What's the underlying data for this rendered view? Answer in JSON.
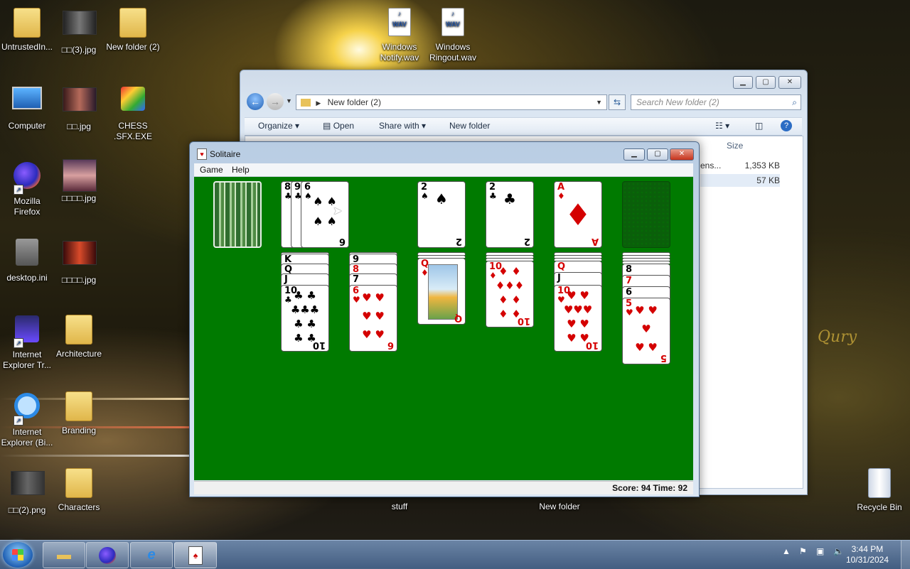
{
  "desktop": {
    "icons": [
      {
        "label": "UntrustedIn..."
      },
      {
        "label": "□□(3).jpg"
      },
      {
        "label": "New folder (2)"
      },
      {
        "label": "Windows Notify.wav"
      },
      {
        "label": "Windows Ringout.wav"
      },
      {
        "label": "Computer"
      },
      {
        "label": "□□.jpg"
      },
      {
        "label": "CHESS .SFX.EXE"
      },
      {
        "label": "Mozilla Firefox"
      },
      {
        "label": "□□□□.jpg"
      },
      {
        "label": "desktop.ini"
      },
      {
        "label": "□□□□.jpg"
      },
      {
        "label": "Internet Explorer Tr..."
      },
      {
        "label": "Architecture"
      },
      {
        "label": "Internet Explorer (Bi..."
      },
      {
        "label": "Branding"
      },
      {
        "label": "□□(2).png"
      },
      {
        "label": "Characters"
      },
      {
        "label": "stuff"
      },
      {
        "label": "New folder"
      },
      {
        "label": "Recycle Bin"
      }
    ]
  },
  "explorer": {
    "address": "New folder (2)",
    "search_placeholder": "Search New folder (2)",
    "toolbar": {
      "organize": "Organize",
      "open": "Open",
      "share_with": "Share with",
      "new_folder": "New folder"
    },
    "column_size": "Size",
    "rows": [
      {
        "name_fragment": "ens...",
        "size": "1,353 KB"
      },
      {
        "name_fragment": "",
        "size": "57 KB"
      }
    ]
  },
  "solitaire": {
    "title": "Solitaire",
    "menu": {
      "game": "Game",
      "help": "Help"
    },
    "status": "Score: 94 Time: 92",
    "waste": [
      {
        "rank": "8",
        "suit": "♣"
      },
      {
        "rank": "9",
        "suit": "♣"
      },
      {
        "rank": "6",
        "suit": "♠"
      }
    ],
    "foundations": [
      {
        "rank": "2",
        "suit": "♠",
        "color": "blk"
      },
      {
        "rank": "2",
        "suit": "♣",
        "color": "blk"
      },
      {
        "rank": "A",
        "suit": "♦",
        "color": "red"
      }
    ],
    "tableau": [
      {
        "peek": [
          "K",
          "Q",
          "J"
        ],
        "top": {
          "rank": "10",
          "suit": "♣",
          "color": "blk"
        }
      },
      {
        "peek": [
          "9",
          "8",
          "7"
        ],
        "top": {
          "rank": "6",
          "suit": "♥",
          "color": "red"
        }
      },
      {
        "peek": [],
        "top": {
          "rank": "Q",
          "suit": "♦",
          "color": "red"
        }
      },
      {
        "peek": [],
        "top": {
          "rank": "10",
          "suit": "♦",
          "color": "red"
        }
      },
      {
        "peek": [
          "Q",
          "J"
        ],
        "top": {
          "rank": "10",
          "suit": "♥",
          "color": "red"
        }
      },
      {
        "peek": [
          "8",
          "7",
          "6"
        ],
        "top": {
          "rank": "5",
          "suit": "♥",
          "color": "red"
        }
      }
    ]
  },
  "taskbar": {
    "time": "3:44 PM",
    "date": "10/31/2024"
  },
  "colors": {
    "felt": "#007a00",
    "taskbar": "#5f83b0"
  }
}
